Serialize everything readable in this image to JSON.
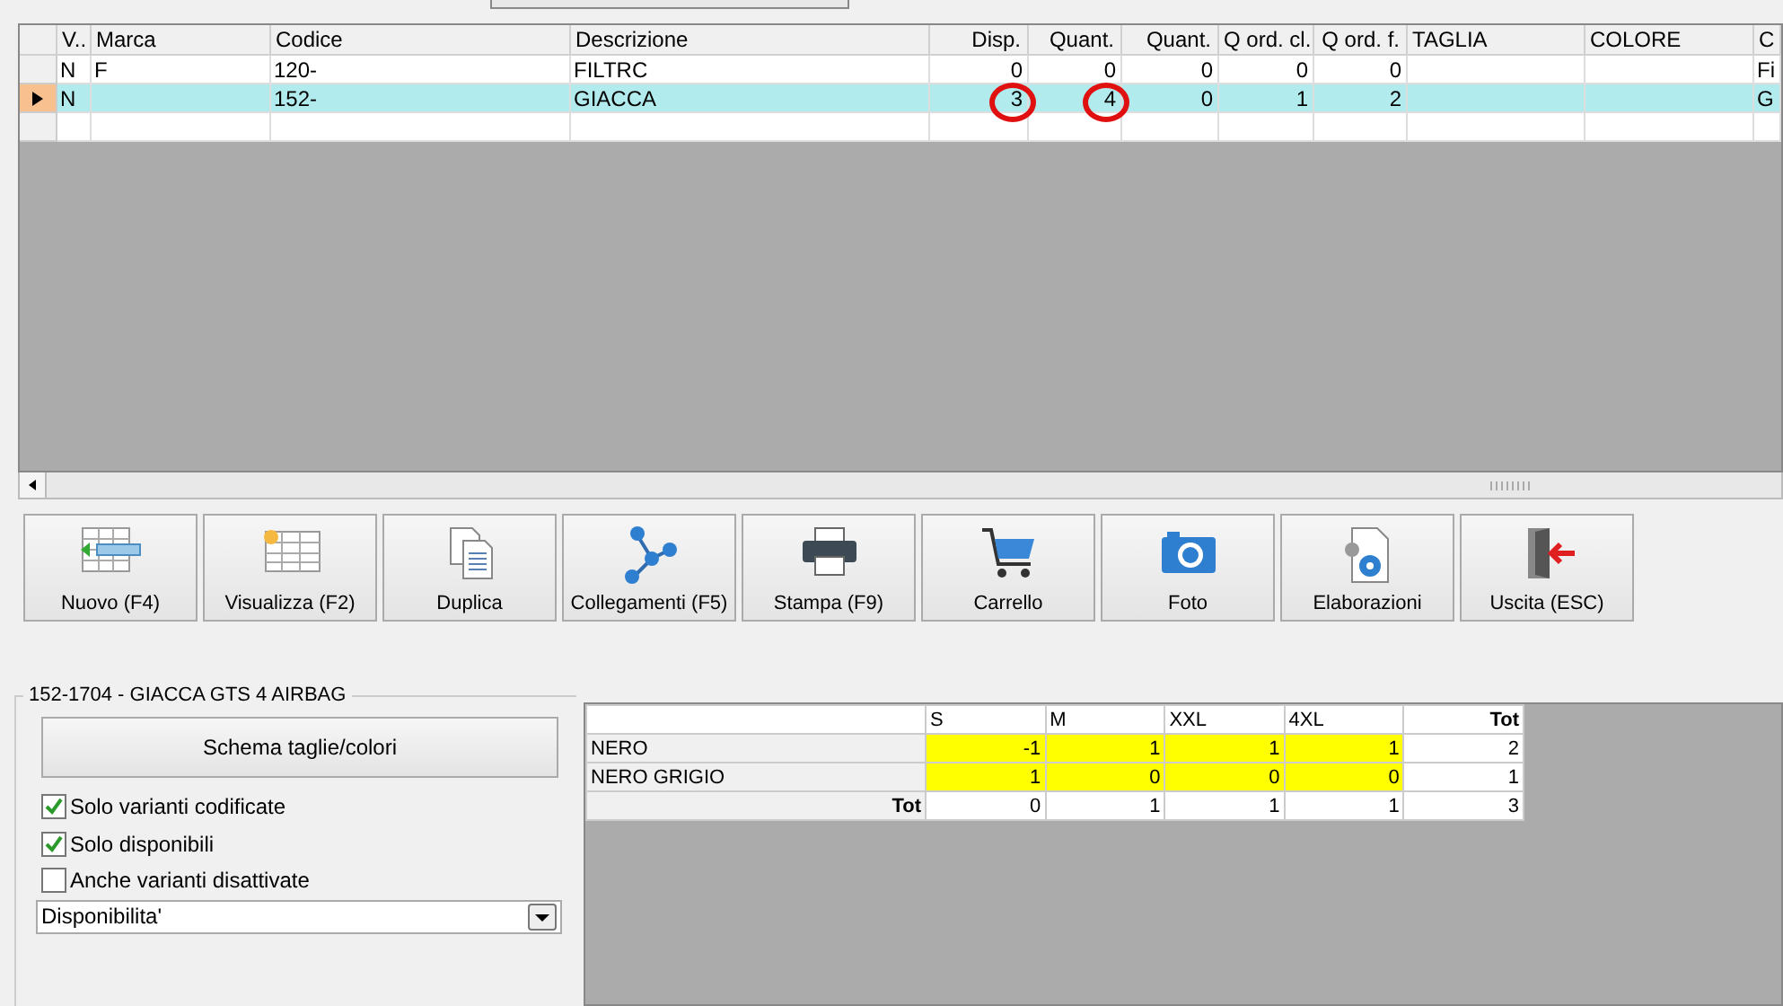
{
  "grid": {
    "columns": [
      {
        "label": "V..",
        "kind": "text"
      },
      {
        "label": "Marca",
        "kind": "text"
      },
      {
        "label": "Codice",
        "kind": "text"
      },
      {
        "label": "Descrizione",
        "kind": "text"
      },
      {
        "label": "Disp.",
        "kind": "number"
      },
      {
        "label": "Quant.",
        "kind": "number"
      },
      {
        "label": "Quant.",
        "kind": "number"
      },
      {
        "label": "Q ord. cl.",
        "kind": "number"
      },
      {
        "label": "Q ord. f.",
        "kind": "number"
      },
      {
        "label": "TAGLIA",
        "kind": "text"
      },
      {
        "label": "COLORE",
        "kind": "text"
      },
      {
        "label": "C",
        "kind": "text"
      }
    ],
    "rows": [
      {
        "selected": false,
        "cells": [
          {
            "text": "N",
            "circled": false
          },
          {
            "text": "F",
            "circled": false
          },
          {
            "text": "120-",
            "circled": false
          },
          {
            "text": "FILTRC",
            "circled": false
          },
          {
            "text": "0",
            "circled": false
          },
          {
            "text": "0",
            "circled": false
          },
          {
            "text": "0",
            "circled": false
          },
          {
            "text": "0",
            "circled": false
          },
          {
            "text": "0",
            "circled": false
          },
          {
            "text": "",
            "circled": false
          },
          {
            "text": "",
            "circled": false
          },
          {
            "text": "Fi",
            "circled": false
          }
        ]
      },
      {
        "selected": true,
        "cells": [
          {
            "text": "N",
            "circled": false
          },
          {
            "text": "",
            "circled": false
          },
          {
            "text": "152-",
            "circled": false
          },
          {
            "text": "GIACCA",
            "circled": false
          },
          {
            "text": "3",
            "circled": true
          },
          {
            "text": "4",
            "circled": true
          },
          {
            "text": "0",
            "circled": false
          },
          {
            "text": "1",
            "circled": false
          },
          {
            "text": "2",
            "circled": false
          },
          {
            "text": "",
            "circled": false
          },
          {
            "text": "",
            "circled": false
          },
          {
            "text": "G",
            "circled": false
          }
        ]
      }
    ]
  },
  "toolbar": [
    {
      "label": "Nuovo (F4)",
      "kind": "new"
    },
    {
      "label": "Visualizza (F2)",
      "kind": "view"
    },
    {
      "label": "Duplica",
      "kind": "copy"
    },
    {
      "label": "Collegamenti (F5)",
      "kind": "links"
    },
    {
      "label": "Stampa (F9)",
      "kind": "print"
    },
    {
      "label": "Carrello",
      "kind": "cart"
    },
    {
      "label": "Foto",
      "kind": "photo"
    },
    {
      "label": "Elaborazioni",
      "kind": "process"
    },
    {
      "label": "Uscita (ESC)",
      "kind": "exit"
    }
  ],
  "details": {
    "title": "152-1704 - GIACCA GTS 4 AIRBAG",
    "schema_button": "Schema taglie/colori",
    "checkboxes": [
      {
        "label": "Solo varianti codificate",
        "checked": true
      },
      {
        "label": "Solo disponibili",
        "checked": true
      },
      {
        "label": "Anche varianti disattivate",
        "checked": false
      }
    ],
    "dropdown": {
      "value": "Disponibilita'"
    }
  },
  "matrix": {
    "columns": [
      "S",
      "M",
      "XXL",
      "4XL",
      "Tot"
    ],
    "rows": [
      {
        "kind": "variant",
        "label": "NERO",
        "cells": [
          "-1",
          "1",
          "1",
          "1",
          "2"
        ]
      },
      {
        "kind": "variant",
        "label": "NERO GRIGIO",
        "cells": [
          "1",
          "0",
          "0",
          "0",
          "1"
        ]
      },
      {
        "kind": "total",
        "label": "Tot",
        "cells": [
          "0",
          "1",
          "1",
          "1",
          "3"
        ]
      }
    ]
  }
}
